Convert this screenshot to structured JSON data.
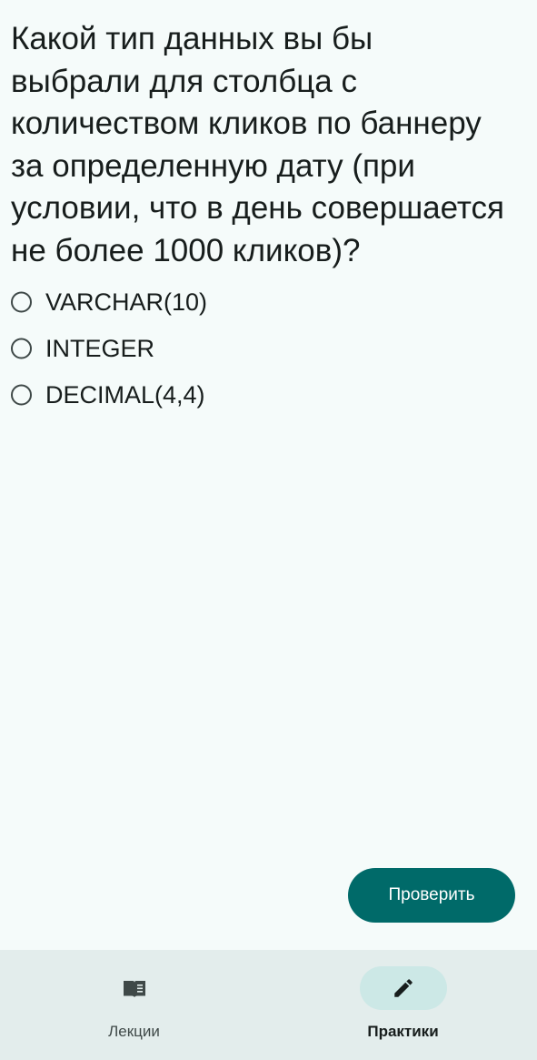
{
  "question": {
    "lines": [
      "Какой тип данных вы бы",
      "выбрали для столбца с",
      "количеством кликов по баннеру",
      "за определенную дату (при",
      "условии, что в день совершается",
      "не более 1000 кликов)?"
    ]
  },
  "options": [
    {
      "label": "VARCHAR(10)",
      "selected": false
    },
    {
      "label": "INTEGER",
      "selected": false
    },
    {
      "label": "DECIMAL(4,4)",
      "selected": false
    }
  ],
  "check_button": {
    "label": "Проверить"
  },
  "bottom_nav": {
    "items": [
      {
        "label": "Лекции",
        "icon": "book-icon",
        "active": false
      },
      {
        "label": "Практики",
        "icon": "pencil-icon",
        "active": true
      }
    ]
  },
  "colors": {
    "background": "#F5FBFA",
    "primary": "#006A69",
    "nav_background": "#E3EDEC",
    "nav_active_pill": "#CCE8E6",
    "text": "#171D1C"
  }
}
